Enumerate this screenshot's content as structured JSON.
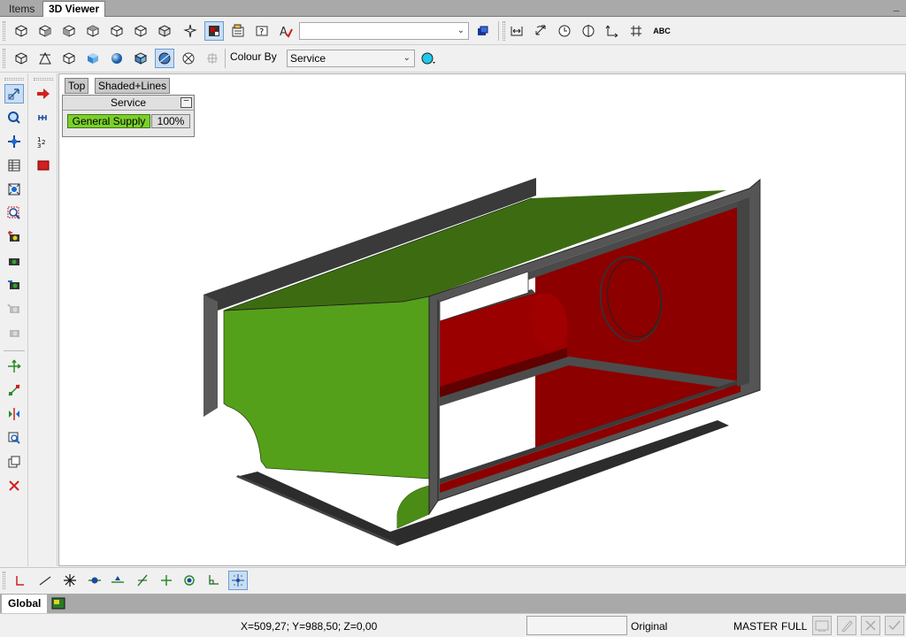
{
  "tabs": [
    {
      "label": "Items",
      "active": false
    },
    {
      "label": "3D Viewer",
      "active": true
    }
  ],
  "window": {
    "minimize_label": "_"
  },
  "toolbar1": {
    "view_buttons": [
      "view-iso-front-left-icon",
      "view-iso-front-right-icon",
      "view-iso-back-left-icon",
      "view-iso-back-right-icon",
      "view-iso-top-icon",
      "view-iso-side-icon",
      "orbit-icon",
      "layer-icon",
      "properties-icon",
      "help-icon",
      "spell-check-icon"
    ],
    "layer_combo_value": "",
    "right_buttons": [
      "distance-icon",
      "rotate-icon",
      "clock-icon",
      "align-icon",
      "axis-icon",
      "move-icon",
      "text-abc-icon"
    ],
    "abc_label": "ABC"
  },
  "toolbar2": {
    "render_buttons": [
      "wireframe-icon",
      "hidden-line-icon",
      "outline-cube-icon",
      "shaded-cube-icon",
      "sphere-icon",
      "shaded-box-icon",
      "shaded-lines-icon",
      "no-shading-icon",
      "grid-icon"
    ],
    "colour_by_label": "Colour By",
    "colour_by_value": "Service",
    "colour_button": "colour-picker-icon"
  },
  "left_bar_1": [
    "select-icon",
    "zoom-window-icon",
    "pan-icon",
    "table-icon",
    "zoom-extents-icon",
    "zoom-selected-icon",
    "camera-add-icon",
    "camera-icon",
    "camera-move-icon",
    "camera-disabled-icon",
    "camera-disabled-2-icon",
    "move-axis-icon",
    "stretch-icon",
    "mirror-icon",
    "inspect-icon",
    "copy-icon",
    "delete-icon"
  ],
  "left_bar_2": [
    "arrow-right-icon",
    "dimension-icon",
    "numbering-icon",
    "fill-red-icon"
  ],
  "viewport": {
    "view_tabs": [
      "Top",
      "Shaded+Lines"
    ],
    "legend": {
      "title": "Service",
      "minimize_label": "–",
      "item_label": "General Supply",
      "item_percent": "100%",
      "item_color": "#7ccf2b"
    },
    "colors": {
      "service_green": "#3f7a10",
      "service_red": "#8c0000",
      "steel": "#555555"
    }
  },
  "bottom_toolbar": [
    "line-snap-icon",
    "angle-snap-icon",
    "cross-snap-icon",
    "node-snap-icon",
    "midpoint-snap-icon",
    "perpendicular-snap-icon",
    "plus-snap-icon",
    "center-snap-icon",
    "corner-snap-icon",
    "grid-snap-icon"
  ],
  "global": {
    "tab_label": "Global"
  },
  "status": {
    "coords": "X=509,27; Y=988,50; Z=0,00",
    "input_value": "",
    "original_label": "Original",
    "master_label": "MASTER",
    "full_label": "FULL"
  }
}
